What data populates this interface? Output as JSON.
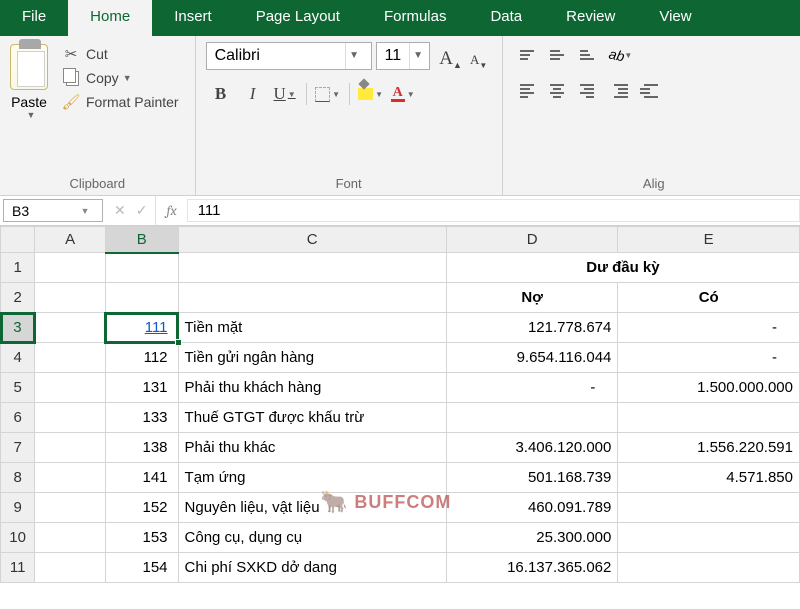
{
  "tabs": {
    "file": "File",
    "home": "Home",
    "insert": "Insert",
    "page_layout": "Page Layout",
    "formulas": "Formulas",
    "data": "Data",
    "review": "Review",
    "view": "View"
  },
  "ribbon": {
    "clipboard": {
      "paste": "Paste",
      "cut": "Cut",
      "copy": "Copy",
      "format_painter": "Format Painter",
      "label": "Clipboard"
    },
    "font": {
      "name": "Calibri",
      "size": "11",
      "bold": "B",
      "italic": "I",
      "underline": "U",
      "grow_a": "A",
      "shrink_a": "A",
      "fontcolor_a": "A",
      "label": "Font"
    },
    "alignment": {
      "label": "Alig"
    }
  },
  "namebox": {
    "value": "B3"
  },
  "formula": {
    "value": "111"
  },
  "watermark": "BUFFCOM",
  "sheet": {
    "cols": [
      "A",
      "B",
      "C",
      "D",
      "E"
    ],
    "header_merged": "Dư đầu kỳ",
    "header_d": "Nợ",
    "header_e": "Có",
    "rows": [
      {
        "n": "1"
      },
      {
        "n": "2"
      },
      {
        "n": "3",
        "b": "111",
        "c": "Tiền mặt",
        "d": "121.778.674",
        "e": "-"
      },
      {
        "n": "4",
        "b": "112",
        "c": "Tiền gửi ngân hàng",
        "d": "9.654.116.044",
        "e": "-"
      },
      {
        "n": "5",
        "b": "131",
        "c": "Phải thu khách hàng",
        "d": "-",
        "e": "1.500.000.000"
      },
      {
        "n": "6",
        "b": "133",
        "c": "Thuế GTGT được khấu trừ",
        "d": "",
        "e": ""
      },
      {
        "n": "7",
        "b": "138",
        "c": "Phải thu khác",
        "d": "3.406.120.000",
        "e": "1.556.220.591"
      },
      {
        "n": "8",
        "b": "141",
        "c": "Tạm ứng",
        "d": "501.168.739",
        "e": "4.571.850"
      },
      {
        "n": "9",
        "b": "152",
        "c": "Nguyên liệu, vật liệu",
        "d": "460.091.789",
        "e": ""
      },
      {
        "n": "10",
        "b": "153",
        "c": "Công cụ, dụng cụ",
        "d": "25.300.000",
        "e": ""
      },
      {
        "n": "11",
        "b": "154",
        "c": "Chi phí SXKD dở dang",
        "d": "16.137.365.062",
        "e": ""
      }
    ]
  }
}
